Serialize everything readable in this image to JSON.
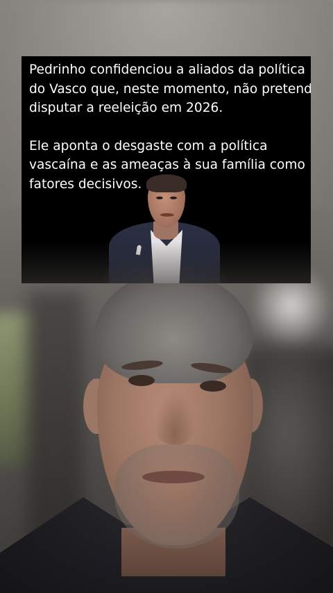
{
  "overlay": {
    "paragraphs": [
      "Pedrinho confidenciou a aliados da política\ndo Vasco que, neste momento, não pretend\ndisputar a reeleição em 2026.",
      "Ele aponta o desgaste com a política\nvascaína e as ameaças à sua família como\nfatores decisivos."
    ],
    "lines_p1": [
      "Pedrinho confidenciou a aliados da política",
      "do Vasco que, neste momento, não pretend",
      "disputar a reeleição em 2026."
    ],
    "lines_p2": [
      "Ele aponta o desgaste com a política",
      "vascaína e as ameaças à sua família como",
      "fatores decisivos."
    ]
  },
  "colors": {
    "card_background": "#000000",
    "card_text": "#ffffff"
  }
}
